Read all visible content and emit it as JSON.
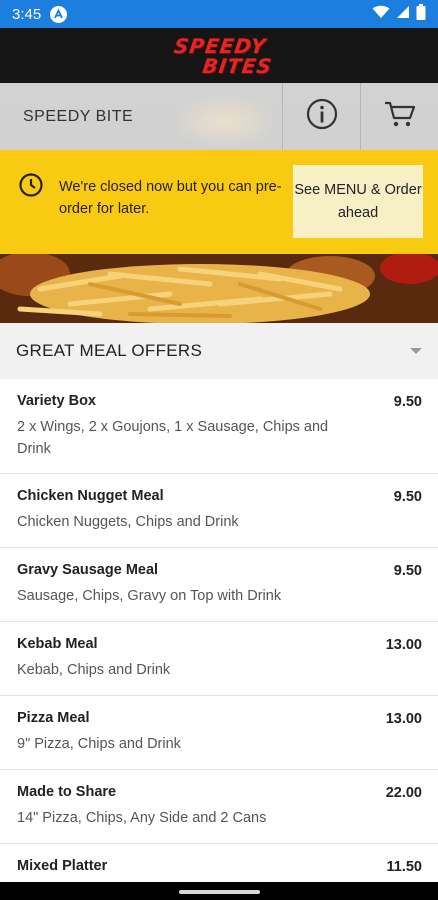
{
  "status_bar": {
    "time": "3:45",
    "app_icon": "app-badge-icon",
    "icons": [
      "wifi-icon",
      "signal-icon",
      "battery-icon"
    ]
  },
  "brand": {
    "logo_line1": "SPEEDY",
    "logo_line2": "BITES",
    "color": "#e52521"
  },
  "header": {
    "store_name": "SPEEDY BITE",
    "info_icon": "info-icon",
    "cart_icon": "cart-icon"
  },
  "notice": {
    "icon": "clock-icon",
    "message": "We're closed now but you can pre-order for later.",
    "button_label": "See MENU & Order ahead",
    "color": "#f8cb12"
  },
  "section": {
    "title": "GREAT MEAL OFFERS",
    "caret_icon": "caret-down-icon"
  },
  "menu_items": [
    {
      "name": "Variety Box",
      "price": "9.50",
      "description": "2 x Wings, 2 x Goujons, 1 x Sausage, Chips and Drink"
    },
    {
      "name": "Chicken Nugget Meal",
      "price": "9.50",
      "description": "Chicken Nuggets, Chips and Drink"
    },
    {
      "name": "Gravy Sausage Meal",
      "price": "9.50",
      "description": "Sausage, Chips, Gravy on Top with Drink"
    },
    {
      "name": "Kebab Meal",
      "price": "13.00",
      "description": "Kebab, Chips and Drink"
    },
    {
      "name": "Pizza Meal",
      "price": "13.00",
      "description": "9\" Pizza, Chips and Drink"
    },
    {
      "name": "Made to Share",
      "price": "22.00",
      "description": "14\" Pizza, Chips, Any Side and 2 Cans"
    },
    {
      "name": "Mixed Platter",
      "price": "11.50",
      "description": ""
    }
  ]
}
